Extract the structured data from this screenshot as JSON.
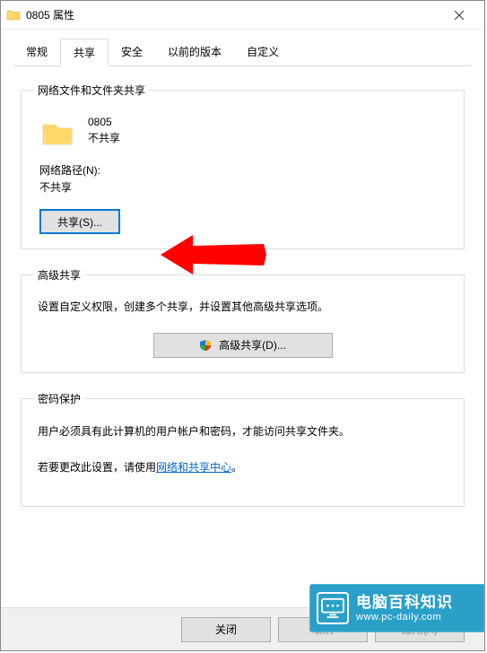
{
  "window": {
    "title": "0805 属性"
  },
  "tabs": {
    "general": "常规",
    "share": "共享",
    "security": "安全",
    "previous": "以前的版本",
    "custom": "自定义"
  },
  "network_share": {
    "legend": "网络文件和文件夹共享",
    "folder_name": "0805",
    "status": "不共享",
    "path_label": "网络路径(N):",
    "path_value": "不共享",
    "share_btn": "共享(S)..."
  },
  "advanced_share": {
    "legend": "高级共享",
    "description": "设置自定义权限，创建多个共享，并设置其他高级共享选项。",
    "btn": "高级共享(D)..."
  },
  "password": {
    "legend": "密码保护",
    "line1": "用户必须具有此计算机的用户帐户和密码，才能访问共享文件夹。",
    "line2_prefix": "若要更改此设置，请使用",
    "link": "网络和共享中心",
    "line2_suffix": "。"
  },
  "footer": {
    "close": "关闭",
    "cancel": "取消",
    "apply": "应用(A)"
  },
  "watermark": {
    "title": "电脑百科知识",
    "url": "www.pc-daily.com"
  }
}
